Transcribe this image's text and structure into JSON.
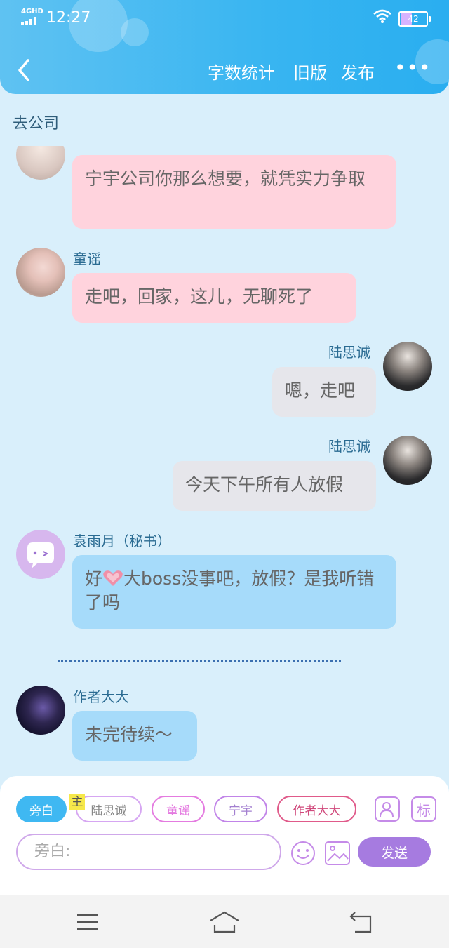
{
  "status_bar": {
    "network": "4GHD",
    "time": "12:27",
    "battery": "42"
  },
  "nav": {
    "word_count": "字数统计",
    "old_version": "旧版",
    "publish": "发布",
    "more": "•••"
  },
  "story_title": "去公司",
  "messages": [
    {
      "speaker": "",
      "text": "宁宇公司你那么想要，就凭实力争取"
    },
    {
      "speaker": "童谣",
      "text": "走吧，回家，这儿，无聊死了"
    },
    {
      "speaker": "陆思诚",
      "text": "嗯，走吧"
    },
    {
      "speaker": "陆思诚",
      "text": "今天下午所有人放假"
    },
    {
      "speaker": "袁雨月（秘书）",
      "text_before": "好",
      "emoji": "heart-emoji",
      "text_after": "大boss没事吧，放假？是我听错了吗"
    },
    {
      "speaker": "作者大大",
      "text": "未完待续～"
    }
  ],
  "composer": {
    "chips": [
      "旁白",
      "陆思诚",
      "童谣",
      "宁宇",
      "作者大大"
    ],
    "main_tag": "主",
    "tag_button": "标",
    "input_placeholder": "旁白:",
    "send_label": "发送"
  },
  "colors": {
    "header": "#38b5f1",
    "background": "#d9effb",
    "pink_bubble": "#ffd3dd",
    "gray_bubble": "#e6e6eb",
    "blue_bubble": "#a6dbfa",
    "send_button": "#a67be0",
    "name_text": "#2a6b92"
  }
}
